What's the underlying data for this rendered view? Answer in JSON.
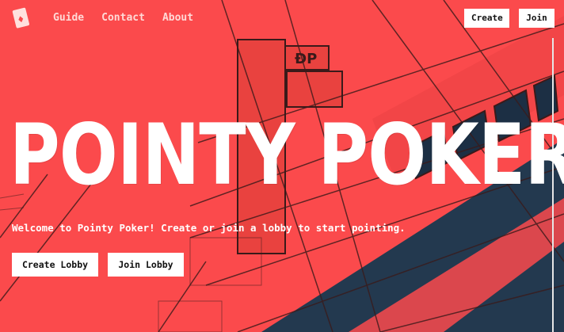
{
  "colors": {
    "hero_red": "#fb4a4c",
    "dark_navy": "#1f3a52",
    "line_dark": "#3a1a1a",
    "text_white": "#ffffff"
  },
  "icons": {
    "logo": "playing-card-logo-icon"
  },
  "nav": {
    "links": [
      "Guide",
      "Contact",
      "About"
    ],
    "create_label": "Create",
    "join_label": "Join"
  },
  "hero": {
    "title": "POINTY POKER",
    "subtitle": "Welcome to Pointy Poker! Create or join a lobby to start pointing.",
    "create_lobby_label": "Create Lobby",
    "join_lobby_label": "Join Lobby"
  }
}
